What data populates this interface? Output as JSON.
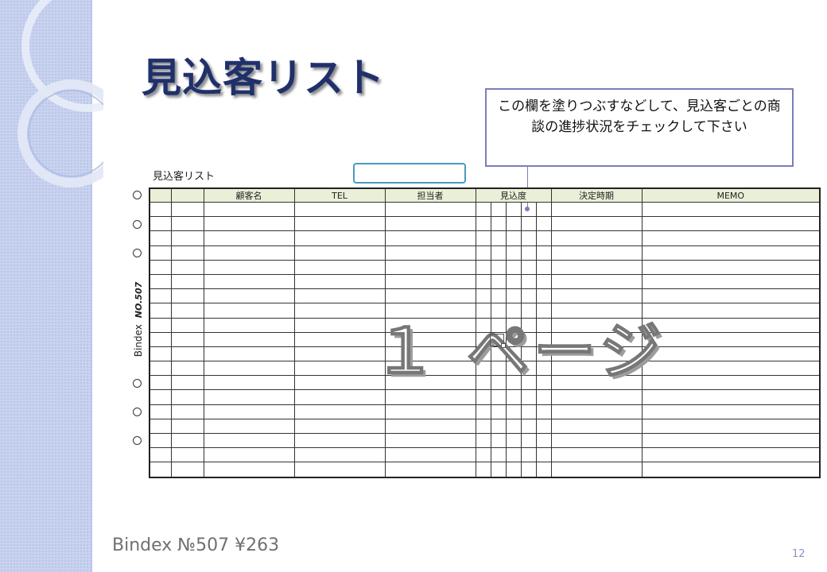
{
  "slide": {
    "title": "見込客リスト",
    "callout_text": "この欄を塗りつぶすなどして、見込客ごとの商談の進捗状況をチェックして下さい",
    "footer": "Bindex №507 ¥263",
    "slide_number": "12"
  },
  "form": {
    "title": "見込客リスト",
    "side_label": "Bindex",
    "side_number": "NO.507",
    "watermark": "１ ページ",
    "columns": [
      "",
      "",
      "顧客名",
      "TEL",
      "担当者",
      "見込度",
      "決定時期",
      "MEMO"
    ],
    "data_row_count": 19
  },
  "colors": {
    "title": "#20306a",
    "header_fill": "#e9f0d7",
    "callout_border": "#7b7fb8",
    "blank_box_border": "#4a9ac0",
    "sidebar": "#c9d3ef"
  }
}
